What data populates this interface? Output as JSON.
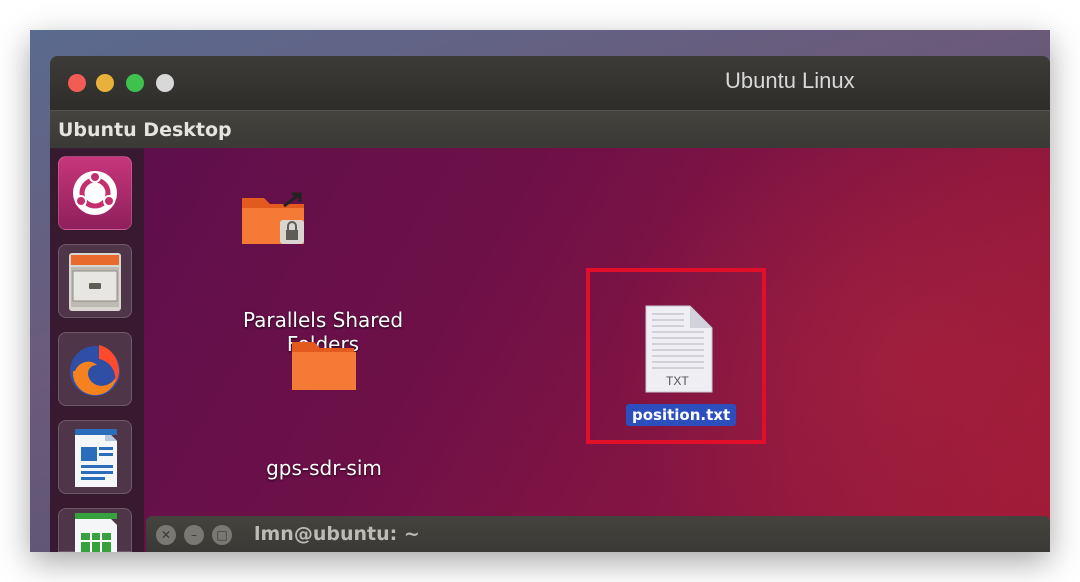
{
  "window": {
    "title": "Ubuntu Linux"
  },
  "menubar": {
    "title": "Ubuntu Desktop"
  },
  "launcher": {
    "items": [
      {
        "icon": "ubuntu-logo-icon"
      },
      {
        "icon": "file-cabinet-icon"
      },
      {
        "icon": "firefox-icon"
      },
      {
        "icon": "writer-document-icon"
      },
      {
        "icon": "spreadsheet-icon"
      }
    ]
  },
  "desktop": {
    "icons": [
      {
        "label_line1": "Parallels Shared",
        "label_line2": "Folders",
        "icon": "shared-folder-icon"
      },
      {
        "label": "gps-sdr-sim",
        "icon": "folder-icon"
      },
      {
        "label": "position.txt",
        "icon": "text-file-icon",
        "file_badge": "TXT"
      }
    ]
  },
  "terminal": {
    "title": "lmn@ubuntu: ~"
  },
  "colors": {
    "selection_outline": "#e10f2a",
    "selected_label_bg": "#2c4fbd"
  }
}
